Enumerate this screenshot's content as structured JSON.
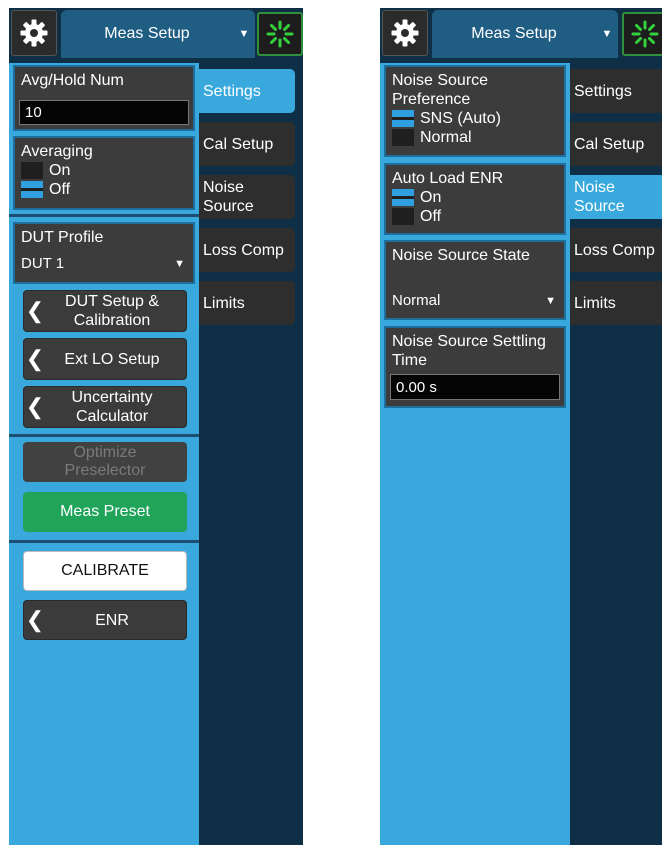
{
  "left": {
    "menu_title": "Meas Setup",
    "tabs": [
      "Settings",
      "Cal Setup",
      "Noise Source",
      "Loss Comp",
      "Limits"
    ],
    "active_tab": "Settings",
    "avg_hold": {
      "label": "Avg/Hold Num",
      "value": "10"
    },
    "averaging": {
      "label": "Averaging",
      "on_label": "On",
      "off_label": "Off",
      "selected": "Off"
    },
    "dut_profile": {
      "label": "DUT Profile",
      "value": "DUT 1"
    },
    "dut_setup_label": "DUT Setup & Calibration",
    "ext_lo_label": "Ext LO Setup",
    "uncertainty_label": "Uncertainty Calculator",
    "optimize_label": "Optimize Preselector",
    "meas_preset_label": "Meas Preset",
    "calibrate_label": "CALIBRATE",
    "enr_label": "ENR"
  },
  "right": {
    "menu_title": "Meas Setup",
    "tabs": [
      "Settings",
      "Cal Setup",
      "Noise Source",
      "Loss Comp",
      "Limits"
    ],
    "active_tab": "Noise Source",
    "preference": {
      "label": "Noise Source Preference",
      "opt1": "SNS (Auto)",
      "opt2": "Normal",
      "selected": "SNS (Auto)"
    },
    "auto_load": {
      "label": "Auto Load ENR",
      "on_label": "On",
      "off_label": "Off",
      "selected": "On"
    },
    "state": {
      "label": "Noise Source State",
      "value": "Normal"
    },
    "settling": {
      "label": "Noise Source Settling Time",
      "value": "0.00 s"
    }
  },
  "icons": {
    "settings": "gear-icon",
    "status": "spinner-icon",
    "dropdown": "caret-down-icon",
    "submenu": "chevron-left-icon"
  },
  "colors": {
    "panel_bg": "#0f2f47",
    "content_bg": "#39a9dd",
    "tab_bg": "#2e2e2e",
    "preset_green": "#1fa45a"
  }
}
